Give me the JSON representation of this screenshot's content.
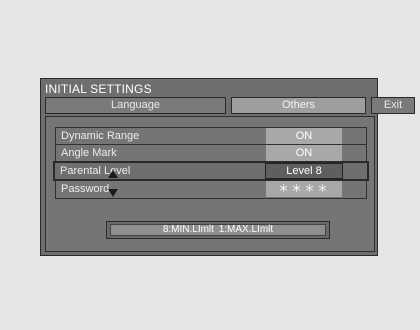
{
  "window": {
    "title": "INITIAL SETTINGS"
  },
  "tabs": [
    {
      "label": "Language"
    },
    {
      "label": "Others"
    },
    {
      "label": "Exit"
    }
  ],
  "settings": [
    {
      "label": "Dynamic Range",
      "value": "ON"
    },
    {
      "label": "Angle Mark",
      "value": "ON"
    },
    {
      "label": "Parental Level",
      "value": "Level 8"
    },
    {
      "label": "Password",
      "value": "＊＊＊＊"
    }
  ],
  "selected_setting": "Parental Level",
  "hint": "8:MIN.LImlt   1:MAX.LImlt",
  "colors": {
    "panel": "#6e6e6e",
    "highlight": "#a8a8a8",
    "active_tab": "#9e9e9e",
    "background": "#e6e6e6"
  }
}
